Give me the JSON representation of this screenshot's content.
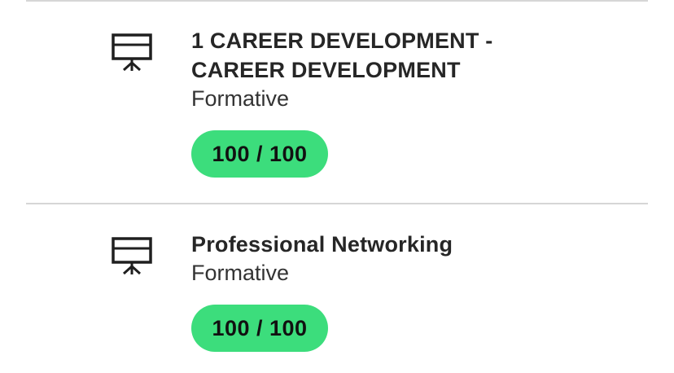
{
  "items": [
    {
      "icon": "presentation-board-icon",
      "title": "1 CAREER DEVELOPMENT - CAREER DEVELOPMENT",
      "type": "Formative",
      "score": "100 / 100"
    },
    {
      "icon": "presentation-board-icon",
      "title": "Professional Networking",
      "type": "Formative",
      "score": "100 / 100"
    }
  ],
  "colors": {
    "badge": "#3cdd7c",
    "divider": "#d6d6d6",
    "text": "#262626"
  }
}
